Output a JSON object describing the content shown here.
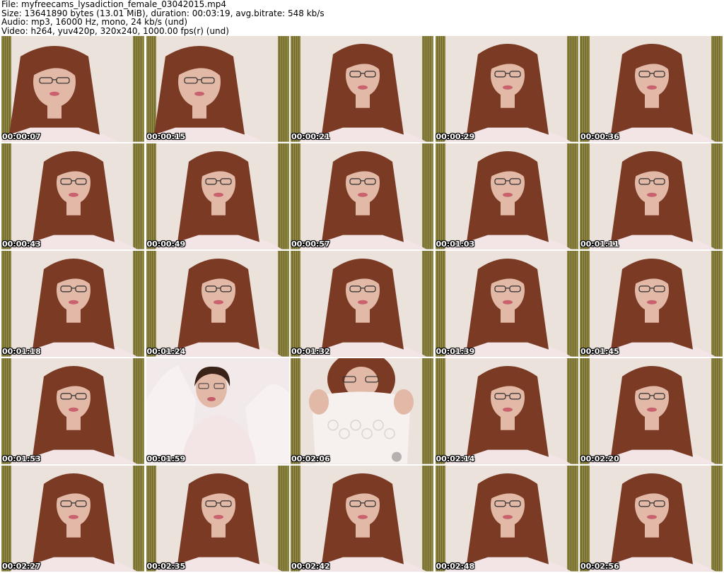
{
  "header": {
    "lines": [
      "File: myfreecams_lysadiction_female_03042015.mp4",
      "Size: 13641890 bytes (13.01 MiB), duration: 00:03:19, avg.bitrate: 548 kb/s",
      "Audio: mp3, 16000 Hz, mono, 24 kb/s (und)",
      "Video: h264, yuv420p, 320x240, 1000.00 fps(r) (und)"
    ]
  },
  "colors": {
    "background": "#ffffff",
    "wall": "#ece2dc",
    "curtain": "#7d7426",
    "hair": "#7a3a24",
    "skin": "#e2b8a6",
    "top": "#f3e4e6",
    "timestamp": "#ffffff"
  },
  "thumbnails": [
    {
      "time": "00:00:07",
      "pose": "close"
    },
    {
      "time": "00:00:15",
      "pose": "close"
    },
    {
      "time": "00:00:21",
      "pose": "normal"
    },
    {
      "time": "00:00:29",
      "pose": "normal"
    },
    {
      "time": "00:00:36",
      "pose": "normal"
    },
    {
      "time": "00:00:43",
      "pose": "normal"
    },
    {
      "time": "00:00:49",
      "pose": "normal"
    },
    {
      "time": "00:00:57",
      "pose": "normal"
    },
    {
      "time": "00:01:03",
      "pose": "normal"
    },
    {
      "time": "00:01:11",
      "pose": "normal"
    },
    {
      "time": "00:01:18",
      "pose": "normal"
    },
    {
      "time": "00:01:24",
      "pose": "normal"
    },
    {
      "time": "00:01:32",
      "pose": "normal"
    },
    {
      "time": "00:01:39",
      "pose": "normal"
    },
    {
      "time": "00:01:45",
      "pose": "normal"
    },
    {
      "time": "00:01:53",
      "pose": "normal"
    },
    {
      "time": "00:01:59",
      "pose": "arms-up"
    },
    {
      "time": "00:02:06",
      "pose": "holding-cloth"
    },
    {
      "time": "00:02:14",
      "pose": "normal"
    },
    {
      "time": "00:02:20",
      "pose": "normal"
    },
    {
      "time": "00:02:27",
      "pose": "normal"
    },
    {
      "time": "00:02:35",
      "pose": "normal"
    },
    {
      "time": "00:02:42",
      "pose": "normal"
    },
    {
      "time": "00:02:48",
      "pose": "normal"
    },
    {
      "time": "00:02:56",
      "pose": "normal"
    }
  ]
}
